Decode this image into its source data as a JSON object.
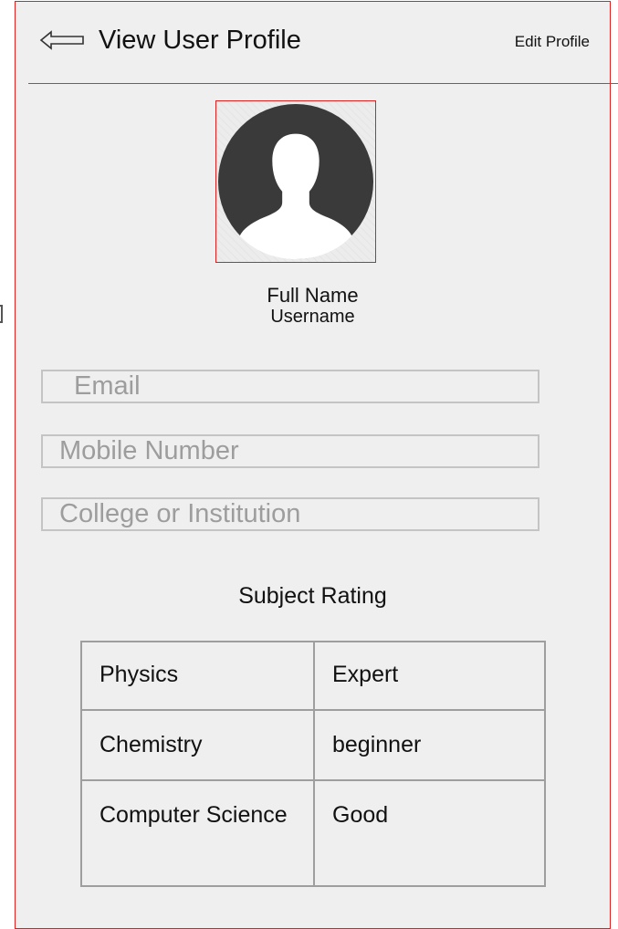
{
  "header": {
    "title": "View User Profile",
    "edit_label": "Edit Profile"
  },
  "profile": {
    "full_name": "Full Name",
    "username": "Username"
  },
  "fields": {
    "email_placeholder": "Email",
    "mobile_placeholder": "Mobile Number",
    "college_placeholder": "College or Institution"
  },
  "subjects": {
    "title": "Subject Rating",
    "rows": [
      {
        "subject": "Physics",
        "rating": "Expert"
      },
      {
        "subject": "Chemistry",
        "rating": "beginner"
      },
      {
        "subject": "Computer Science",
        "rating": "Good"
      }
    ]
  },
  "icons": {
    "back": "arrow-left-icon",
    "avatar": "user-silhouette-icon"
  },
  "colors": {
    "frame_border": "#e0201f",
    "background": "#efefef",
    "avatar_fill": "#3a3a3a",
    "field_border": "#c4c4c4",
    "placeholder": "#9d9d9d",
    "table_border": "#9e9e9e"
  }
}
